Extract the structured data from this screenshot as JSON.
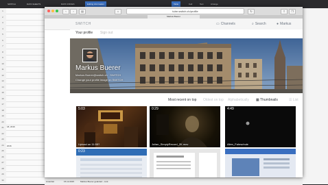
{
  "sheet": {
    "tabs": [
      "SWITCH",
      "DATA SHEETS",
      "DATA VOICES",
      "Editing information"
    ],
    "right_tabs": [
      "Table",
      "Cell",
      "Text",
      "Arrange"
    ],
    "row_numbers": [
      "1",
      "2",
      "3",
      "4",
      "5",
      "6",
      "7",
      "8",
      "9",
      "10",
      "11",
      "12",
      "13",
      "14",
      "15",
      "16",
      "17",
      "18",
      "19",
      "20",
      "21",
      "22",
      "23",
      "24",
      "25",
      "26",
      "27",
      "28",
      "29",
      "30"
    ],
    "cells": {
      "c1": "18, 2016",
      "c2": "2016"
    },
    "bottom_row": [
      "Untertitel",
      "15.12.2015",
      "Markus Buerer geändert - Link"
    ]
  },
  "browser": {
    "address": "tube.switch.ch/profile",
    "tab_title": "Markus Buerer"
  },
  "site": {
    "logo": "SWITCH",
    "nav": {
      "channels": "Channels",
      "search": "Search",
      "user": "Markus"
    },
    "profile_tabs": {
      "profile": "Your profile",
      "signout": "Sign out"
    },
    "profile": {
      "name": "Markus Buerer",
      "subtitle1": "Markus.Buerer@switch.ch · SWITCH",
      "subtitle2": "Change your profile image on SWITCH"
    },
    "sort": {
      "recent": "Most recent on top",
      "oldest": "Oldest on top",
      "alpha": "Alphabetically",
      "thumbnails": "Thumbnails",
      "list": "List"
    },
    "videos": [
      {
        "duration": "5:03",
        "title": "Upload on 11:55?"
      },
      {
        "duration": "0:29",
        "title": "Julian_SimplyRecord_2K.mov"
      },
      {
        "duration": "4:49",
        "title": "Alien_Fahrschule"
      },
      {
        "duration": "0:23",
        "title": ""
      },
      {
        "duration": "",
        "title": ""
      },
      {
        "duration": "",
        "title": ""
      }
    ]
  },
  "colors": {
    "accent": "#3a6fc0",
    "nav_text": "#6b7480",
    "traffic_close": "#fc605b",
    "traffic_min": "#fdbc40",
    "traffic_max": "#34c84a"
  }
}
